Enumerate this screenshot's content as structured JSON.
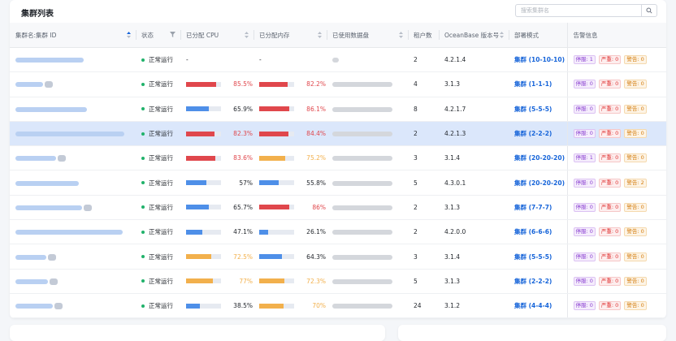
{
  "header": {
    "title": "集群列表"
  },
  "search": {
    "placeholder": "搜索集群名"
  },
  "columns": {
    "name": "集群名:集群 ID",
    "status": "状态",
    "cpu": "已分配 CPU",
    "mem": "已分配内存",
    "disk": "已使用数据盘",
    "tenants": "租户数",
    "version": "OceanBase 版本号",
    "mode": "部署模式",
    "alerts": "告警信息"
  },
  "colors": {
    "red": "#e0474c",
    "blue": "#4e8fe8",
    "orange": "#f2b04c",
    "green": "#21b26b"
  },
  "rows": [
    {
      "status": "正常运行",
      "cpu": "-",
      "cpu_pct": null,
      "cpu_color": "",
      "mem": "-",
      "mem_pct": null,
      "mem_color": "",
      "tenants": "2",
      "version": "4.2.1.4",
      "mode": "集群 (10-10-10)",
      "a1": "停服: 1",
      "a2": "严重: 0",
      "a3": "警告: 0",
      "selected": false
    },
    {
      "status": "正常运行",
      "cpu": "85.5%",
      "cpu_pct": 85.5,
      "cpu_color": "red",
      "mem": "82.2%",
      "mem_pct": 82.2,
      "mem_color": "red",
      "tenants": "4",
      "version": "3.1.3",
      "mode": "集群 (1-1-1)",
      "a1": "停服: 0",
      "a2": "严重: 0",
      "a3": "警告: 0",
      "selected": false
    },
    {
      "status": "正常运行",
      "cpu": "65.9%",
      "cpu_pct": 65.9,
      "cpu_color": "blue",
      "mem": "86.1%",
      "mem_pct": 86.1,
      "mem_color": "red",
      "tenants": "8",
      "version": "4.2.1.7",
      "mode": "集群 (5-5-5)",
      "a1": "停服: 0",
      "a2": "严重: 0",
      "a3": "警告: 0",
      "selected": false
    },
    {
      "status": "正常运行",
      "cpu": "82.3%",
      "cpu_pct": 82.3,
      "cpu_color": "red",
      "mem": "84.4%",
      "mem_pct": 84.4,
      "mem_color": "red",
      "tenants": "2",
      "version": "4.2.1.3",
      "mode": "集群 (2-2-2)",
      "a1": "停服: 0",
      "a2": "严重: 0",
      "a3": "警告: 0",
      "selected": true
    },
    {
      "status": "正常运行",
      "cpu": "83.6%",
      "cpu_pct": 83.6,
      "cpu_color": "red",
      "mem": "75.2%",
      "mem_pct": 75.2,
      "mem_color": "orange",
      "tenants": "3",
      "version": "3.1.4",
      "mode": "集群 (20-20-20)",
      "a1": "停服: 1",
      "a2": "严重: 0",
      "a3": "警告: 0",
      "selected": false
    },
    {
      "status": "正常运行",
      "cpu": "57%",
      "cpu_pct": 57,
      "cpu_color": "blue",
      "mem": "55.8%",
      "mem_pct": 55.8,
      "mem_color": "blue",
      "tenants": "5",
      "version": "4.3.0.1",
      "mode": "集群 (20-20-20)",
      "a1": "停服: 0",
      "a2": "严重: 0",
      "a3": "警告: 2",
      "selected": false
    },
    {
      "status": "正常运行",
      "cpu": "65.7%",
      "cpu_pct": 65.7,
      "cpu_color": "blue",
      "mem": "86%",
      "mem_pct": 86,
      "mem_color": "red",
      "tenants": "2",
      "version": "3.1.3",
      "mode": "集群 (7-7-7)",
      "a1": "停服: 0",
      "a2": "严重: 0",
      "a3": "警告: 0",
      "selected": false
    },
    {
      "status": "正常运行",
      "cpu": "47.1%",
      "cpu_pct": 47.1,
      "cpu_color": "blue",
      "mem": "26.1%",
      "mem_pct": 26.1,
      "mem_color": "blue",
      "tenants": "2",
      "version": "4.2.0.0",
      "mode": "集群 (6-6-6)",
      "a1": "停服: 0",
      "a2": "严重: 0",
      "a3": "警告: 0",
      "selected": false
    },
    {
      "status": "正常运行",
      "cpu": "72.5%",
      "cpu_pct": 72.5,
      "cpu_color": "orange",
      "mem": "64.3%",
      "mem_pct": 64.3,
      "mem_color": "blue",
      "tenants": "3",
      "version": "3.1.4",
      "mode": "集群 (5-5-5)",
      "a1": "停服: 0",
      "a2": "严重: 0",
      "a3": "警告: 0",
      "selected": false
    },
    {
      "status": "正常运行",
      "cpu": "77%",
      "cpu_pct": 77,
      "cpu_color": "orange",
      "mem": "72.3%",
      "mem_pct": 72.3,
      "mem_color": "orange",
      "tenants": "5",
      "version": "3.1.3",
      "mode": "集群 (2-2-2)",
      "a1": "停服: 0",
      "a2": "严重: 0",
      "a3": "警告: 0",
      "selected": false
    },
    {
      "status": "正常运行",
      "cpu": "38.5%",
      "cpu_pct": 38.5,
      "cpu_color": "blue",
      "mem": "70%",
      "mem_pct": 70,
      "mem_color": "orange",
      "tenants": "24",
      "version": "3.1.2",
      "mode": "集群 (4-4-4)",
      "a1": "停服: 0",
      "a2": "严重: 0",
      "a3": "警告: 0",
      "selected": false
    }
  ]
}
